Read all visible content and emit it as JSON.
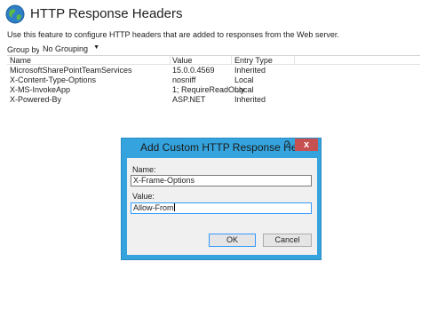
{
  "header": {
    "title": "HTTP Response Headers",
    "description": "Use this feature to configure HTTP headers that are added to responses from the Web server."
  },
  "group_by": {
    "label": "Group by:",
    "value": "No Grouping"
  },
  "table": {
    "columns": [
      "Name",
      "Value",
      "Entry Type"
    ],
    "rows": [
      {
        "name": "MicrosoftSharePointTeamServices",
        "value": "15.0.0.4569",
        "type": "Inherited"
      },
      {
        "name": "X-Content-Type-Options",
        "value": "nosniff",
        "type": "Local"
      },
      {
        "name": "X-MS-InvokeApp",
        "value": "1; RequireReadOnly",
        "type": "Local"
      },
      {
        "name": "X-Powered-By",
        "value": "ASP.NET",
        "type": "Inherited"
      }
    ]
  },
  "dialog": {
    "title": "Add Custom HTTP Response Header",
    "help_glyph": "?",
    "close_glyph": "x",
    "name_label": "Name:",
    "name_value": "X-Frame-Options",
    "value_label": "Value:",
    "value_value": "Allow-From",
    "ok_label": "OK",
    "cancel_label": "Cancel"
  },
  "colors": {
    "dialog_frame": "#35a4de",
    "close_button": "#c75050"
  },
  "icons": {
    "header_icon": "globe-icon"
  }
}
